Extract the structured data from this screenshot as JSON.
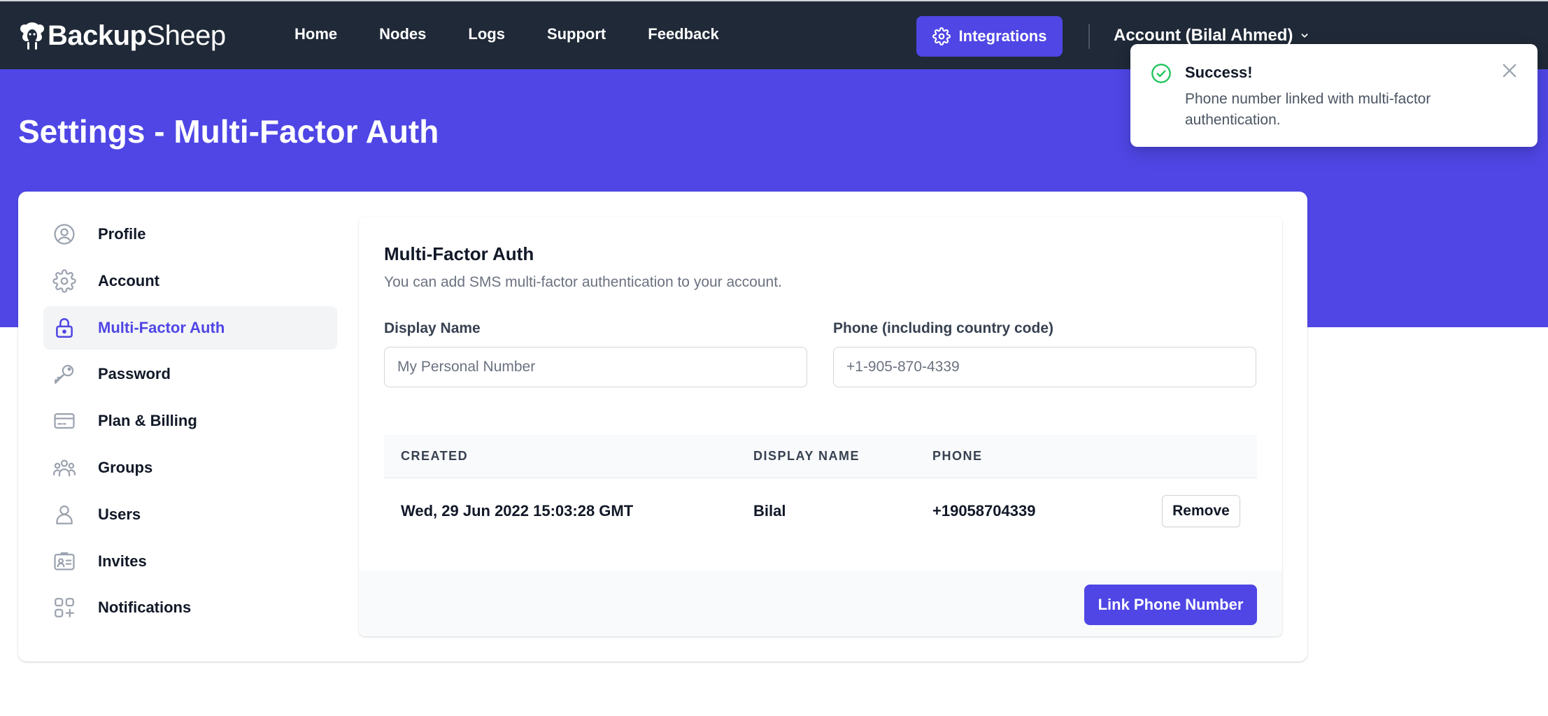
{
  "brand": {
    "name_bold": "Backup",
    "name_rest": "Sheep"
  },
  "nav": {
    "links": [
      "Home",
      "Nodes",
      "Logs",
      "Support",
      "Feedback"
    ],
    "integrations_label": "Integrations",
    "account_label": "Account (Bilal Ahmed)"
  },
  "page": {
    "title": "Settings - Multi-Factor Auth"
  },
  "sidebar": {
    "items": [
      {
        "label": "Profile",
        "icon": "user-circle-icon",
        "active": false
      },
      {
        "label": "Account",
        "icon": "gear-icon",
        "active": false
      },
      {
        "label": "Multi-Factor Auth",
        "icon": "lock-icon",
        "active": true
      },
      {
        "label": "Password",
        "icon": "key-icon",
        "active": false
      },
      {
        "label": "Plan & Billing",
        "icon": "credit-card-icon",
        "active": false
      },
      {
        "label": "Groups",
        "icon": "user-group-icon",
        "active": false
      },
      {
        "label": "Users",
        "icon": "user-icon",
        "active": false
      },
      {
        "label": "Invites",
        "icon": "id-card-icon",
        "active": false
      },
      {
        "label": "Notifications",
        "icon": "apps-add-icon",
        "active": false
      }
    ]
  },
  "mfa": {
    "title": "Multi-Factor Auth",
    "description": "You can add SMS multi-factor authentication to your account.",
    "display_name_label": "Display Name",
    "display_name_placeholder": "My Personal Number",
    "display_name_value": "",
    "phone_label": "Phone (including country code)",
    "phone_placeholder": "+1-905-870-4339",
    "phone_value": "",
    "table": {
      "headers": [
        "Created",
        "Display Name",
        "Phone"
      ],
      "rows": [
        {
          "created": "Wed, 29 Jun 2022 15:03:28 GMT",
          "display_name": "Bilal",
          "phone": "+19058704339",
          "action": "Remove"
        }
      ]
    },
    "link_button_label": "Link Phone Number"
  },
  "toast": {
    "title": "Success!",
    "message": "Phone number linked with multi-factor authentication."
  },
  "colors": {
    "accent": "#4f46e5",
    "nav_bg": "#1f2937",
    "success": "#22c55e",
    "muted_text": "#6b7280"
  }
}
